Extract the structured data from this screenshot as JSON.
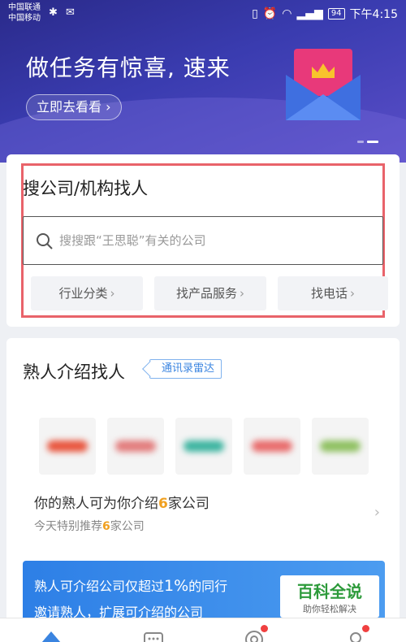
{
  "status_bar": {
    "carrier_1": "中国联通",
    "carrier_2": "中国移动",
    "battery": "94",
    "time": "下午4:15"
  },
  "banner": {
    "title": "做任务有惊喜, 速来",
    "button_label": "立即去看看",
    "button_chevron": "›"
  },
  "search": {
    "title": "搜公司/机构找人",
    "placeholder": "搜搜跟“王思聪”有关的公司",
    "chips": [
      {
        "label": "行业分类",
        "chevron": "›"
      },
      {
        "label": "找产品服务",
        "chevron": "›"
      },
      {
        "label": "找电话",
        "chevron": "›"
      }
    ],
    "highlight_color": "#e9636a"
  },
  "referral": {
    "title": "熟人介绍找人",
    "tag": "通讯录雷达",
    "logos": [
      {
        "name": "blurred-company-logo-1",
        "color": "#e8543c"
      },
      {
        "name": "blurred-company-logo-2",
        "color": "#e27b7b"
      },
      {
        "name": "blurred-company-logo-3",
        "color": "#3cb4a0"
      },
      {
        "name": "blurred-company-logo-4",
        "color": "#e86a6a"
      },
      {
        "name": "blurred-company-logo-5",
        "color": "#8ec060"
      }
    ],
    "desc_prefix": "你的熟人可为你介绍",
    "desc_count": "6",
    "desc_suffix": "家公司",
    "sub_prefix": "今天特别推荐",
    "sub_count": "6",
    "sub_suffix": "家公司",
    "arrow": "›"
  },
  "invite": {
    "line1_prefix": "熟人可介绍公司仅超过",
    "line1_percent": "1%",
    "line1_suffix": "的同行",
    "line2": "邀请熟人，扩展可介绍的公司"
  },
  "watermark": {
    "main": "百科全说",
    "sub": "助你轻松解决"
  },
  "colors": {
    "accent_blue": "#3a84e0",
    "number_orange": "#f0a020",
    "badge_red": "#f04040"
  }
}
